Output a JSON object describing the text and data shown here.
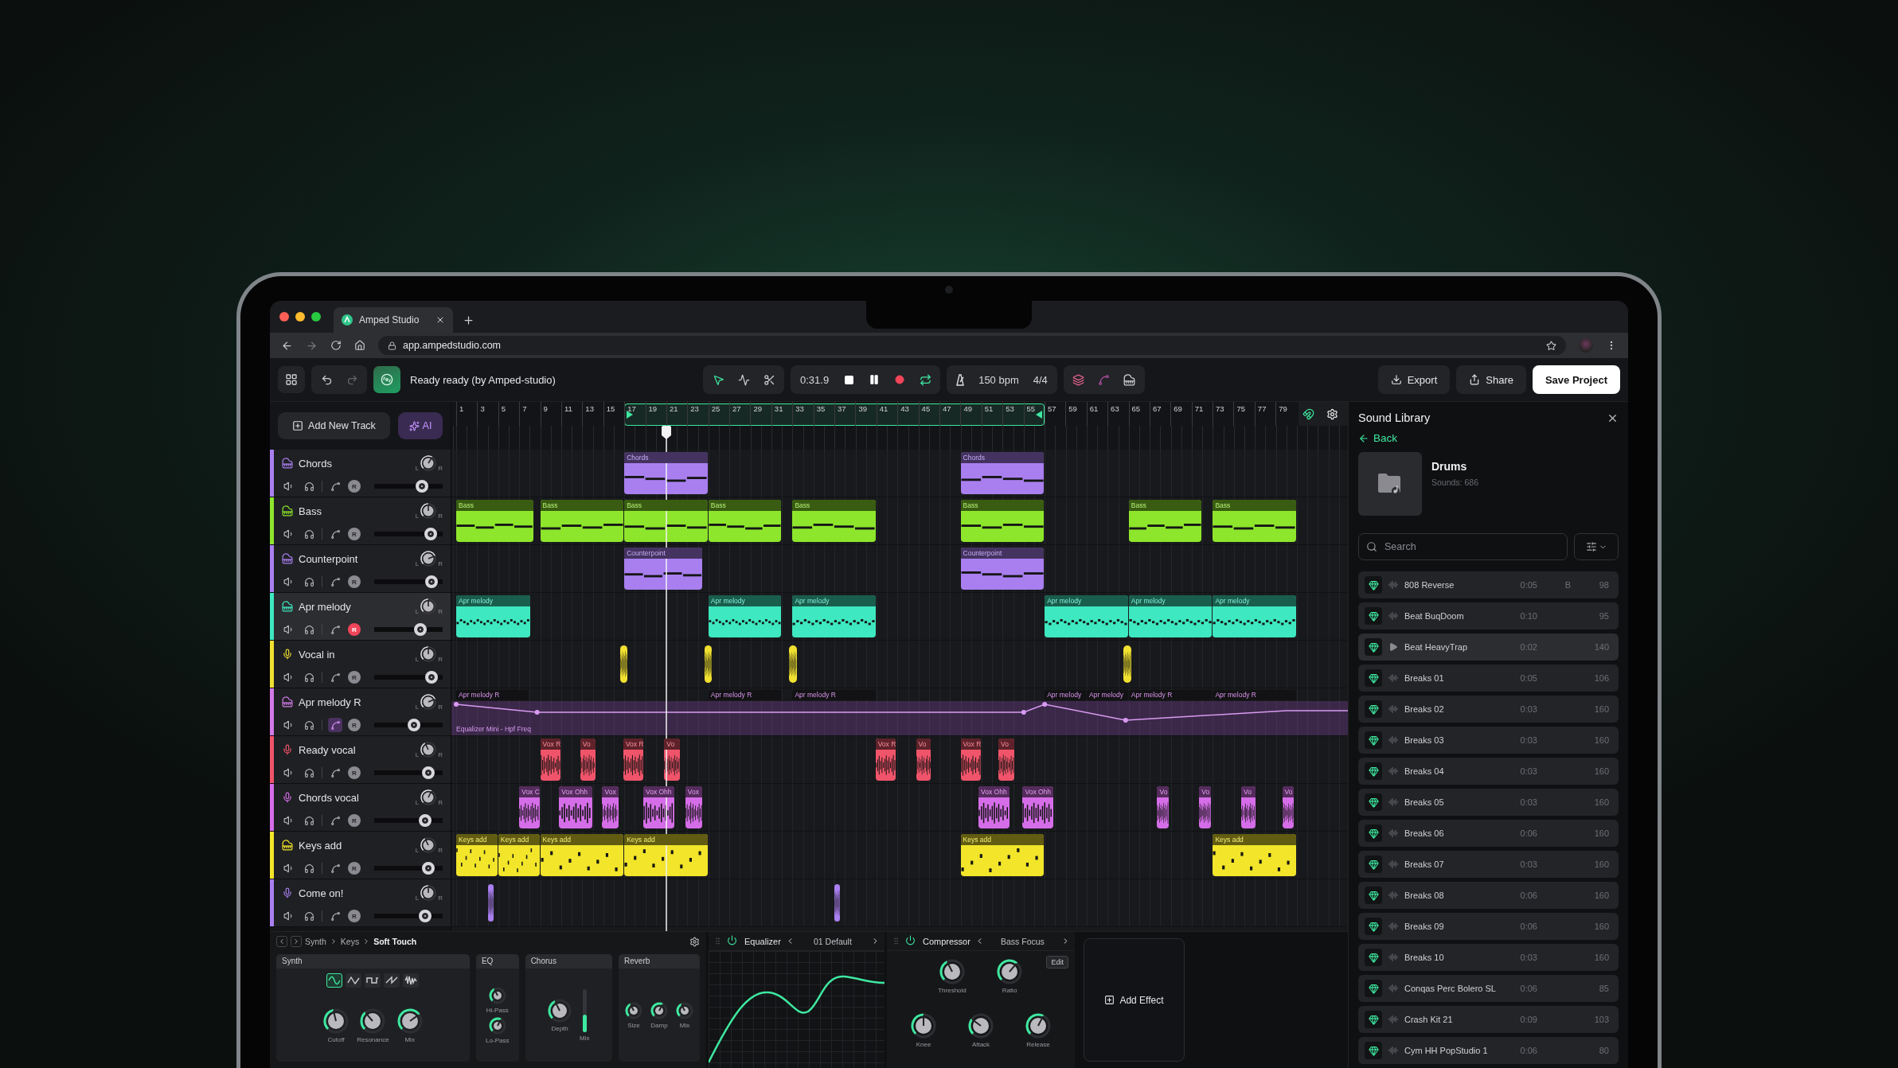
{
  "browser": {
    "tab": {
      "title": "Amped Studio",
      "selected": true
    },
    "url": "app.ampedstudio.com"
  },
  "toolbar": {
    "project_title": "Ready ready (by Amped-studio)",
    "tools": [
      {
        "kind": "pointer",
        "selected": true
      },
      {
        "kind": "split",
        "selected": false
      },
      {
        "kind": "cut",
        "selected": false
      }
    ],
    "time": "0:31.9",
    "loop": true,
    "tempo": "150 bpm",
    "meter": "4/4",
    "buttons": [
      {
        "kind": "export",
        "label": "Export"
      },
      {
        "kind": "share",
        "label": "Share"
      },
      {
        "kind": "save",
        "label": "Save Project"
      }
    ]
  },
  "track_list": {
    "add_button": "Add New Track",
    "ai_button": "AI"
  },
  "ruler": {
    "marks": [
      "1",
      "3",
      "5",
      "7",
      "9",
      "11",
      "13",
      "15",
      "17",
      "19",
      "21",
      "23",
      "25",
      "27",
      "29",
      "31",
      "33",
      "35",
      "37",
      "39",
      "41",
      "43",
      "45",
      "47",
      "49",
      "51",
      "53",
      "55",
      "57",
      "59",
      "61",
      "63",
      "65",
      "67",
      "69",
      "71",
      "73",
      "75",
      "77",
      "79"
    ]
  },
  "tracks": [
    {
      "name": "Chords",
      "kind": "midi",
      "color": "#a97ff0",
      "selected": false,
      "automation": false,
      "pan": {
        "left": "L",
        "right": "R",
        "level": 0.62
      },
      "record": {
        "label": "R",
        "armed": false
      },
      "volume": {
        "level": 0.74
      },
      "clips": [
        {
          "label": "Chords"
        },
        {
          "label": "Chords"
        }
      ]
    },
    {
      "name": "Bass",
      "kind": "midi",
      "color": "#8ee62c",
      "selected": false,
      "automation": false,
      "pan": {
        "left": "L",
        "right": "R",
        "level": 0.5
      },
      "record": {
        "label": "R",
        "armed": false
      },
      "volume": {
        "level": 0.9
      },
      "clips": [
        {
          "label": "Bass"
        },
        {
          "label": "Bass"
        },
        {
          "label": "Bass"
        },
        {
          "label": "Bass"
        },
        {
          "label": "Bass"
        },
        {
          "label": "Bass"
        },
        {
          "label": "Bass"
        },
        {
          "label": "Bass"
        }
      ]
    },
    {
      "name": "Counterpoint",
      "kind": "midi",
      "color": "#a97ff0",
      "selected": false,
      "automation": false,
      "pan": {
        "left": "L",
        "right": "R",
        "level": 0.75
      },
      "record": {
        "label": "R",
        "armed": false
      },
      "volume": {
        "level": 0.92
      },
      "clips": [
        {
          "label": "Counterpoint"
        },
        {
          "label": "Counterpoint"
        }
      ]
    },
    {
      "name": "Apr melody",
      "kind": "midi",
      "color": "#3ee8c0",
      "selected": true,
      "automation": false,
      "pan": {
        "left": "L",
        "right": "R",
        "level": 0.5
      },
      "record": {
        "label": "R",
        "armed": true
      },
      "volume": {
        "level": 0.72
      },
      "clips": [
        {
          "label": "Apr melody"
        },
        {
          "label": "Apr melody"
        },
        {
          "label": "Apr melody"
        },
        {
          "label": "Apr melody"
        },
        {
          "label": "Apr melody"
        },
        {
          "label": "Apr melody"
        }
      ]
    },
    {
      "name": "Vocal in",
      "kind": "audio",
      "color": "#f0e030",
      "selected": false,
      "automation": false,
      "pan": {
        "left": "L",
        "right": "R",
        "level": 0.5
      },
      "record": {
        "label": "R",
        "armed": false
      },
      "volume": {
        "level": 0.92
      },
      "clips": [
        {
          "kind": "audio"
        },
        {
          "kind": "audio"
        },
        {
          "kind": "audio"
        },
        {
          "kind": "audio"
        }
      ]
    },
    {
      "name": "Apr melody R",
      "kind": "midi",
      "color": "#d17ae8",
      "selected": false,
      "automation": true,
      "pan": {
        "left": "L",
        "right": "R",
        "level": 0.75
      },
      "record": {
        "label": "R",
        "armed": false
      },
      "volume": {
        "level": 0.6
      },
      "automation_lane": {
        "label": "Equalizer Mini - Hpf Freq"
      },
      "clips": [
        {
          "label": "Apr melody R"
        },
        {
          "label": "Apr melody R"
        },
        {
          "label": "Apr melody R"
        },
        {
          "label": "Apr melody"
        },
        {
          "label": "Apr melody"
        },
        {
          "label": "Apr melody R"
        },
        {
          "label": "Apr melody R"
        }
      ]
    },
    {
      "name": "Ready vocal",
      "kind": "audio",
      "color": "#f0546a",
      "selected": false,
      "automation": false,
      "pan": {
        "left": "L",
        "right": "R",
        "level": 0.4
      },
      "record": {
        "label": "R",
        "armed": false
      },
      "volume": {
        "level": 0.86
      },
      "clips": [
        {
          "label": "Vox R"
        },
        {
          "label": "Vo"
        },
        {
          "label": "Vox R"
        },
        {
          "label": "Vo"
        },
        {
          "label": "Vox R"
        },
        {
          "label": "Vo"
        },
        {
          "label": "Vox R"
        },
        {
          "label": "Vo"
        }
      ]
    },
    {
      "name": "Chords vocal",
      "kind": "audio",
      "color": "#d56de8",
      "selected": false,
      "automation": false,
      "pan": {
        "left": "L",
        "right": "R",
        "level": 0.6
      },
      "record": {
        "label": "R",
        "armed": false
      },
      "volume": {
        "level": 0.8
      },
      "clips": [
        {
          "label": "Vox C"
        },
        {
          "label": "Vox Ohh"
        },
        {
          "label": "Vox"
        },
        {
          "label": "Vox Ohh"
        },
        {
          "label": "Vox"
        },
        {
          "label": "Vox Ohh"
        },
        {
          "label": "Vox Ohh"
        },
        {
          "label": "Vo"
        },
        {
          "label": "Vo"
        },
        {
          "label": "Vo"
        },
        {
          "label": "Vo"
        }
      ]
    },
    {
      "name": "Keys add",
      "kind": "midi",
      "color": "#f2e52a",
      "selected": false,
      "automation": false,
      "pan": {
        "left": "L",
        "right": "R",
        "level": 0.4
      },
      "record": {
        "label": "R",
        "armed": false
      },
      "volume": {
        "level": 0.86
      },
      "clips": [
        {
          "label": "Keys add"
        },
        {
          "label": "Keys add"
        },
        {
          "label": "Keys add"
        },
        {
          "label": "Keys add"
        },
        {
          "label": "Keys add"
        },
        {
          "label": "Keys add"
        }
      ]
    },
    {
      "name": "Come on!",
      "kind": "audio",
      "color": "#a97ff0",
      "selected": false,
      "automation": false,
      "pan": {
        "left": "L",
        "right": "R",
        "level": 0.5
      },
      "record": {
        "label": "R",
        "armed": false
      },
      "volume": {
        "level": 0.8
      },
      "clips": [
        {
          "kind": "audio"
        },
        {
          "kind": "audio"
        }
      ]
    }
  ],
  "instrument": {
    "breadcrumb": [
      "Synth",
      "Keys",
      "Soft Touch"
    ],
    "modules": [
      {
        "title": "Synth",
        "kind": "synth",
        "waves": [
          {
            "kind": "sine",
            "selected": true
          },
          {
            "kind": "triangle",
            "selected": false
          },
          {
            "kind": "square",
            "selected": false
          },
          {
            "kind": "saw",
            "selected": false
          },
          {
            "kind": "noise",
            "selected": false
          }
        ],
        "knobs": [
          {
            "label": "Cutoff",
            "level": 0.45
          },
          {
            "label": "Resonance",
            "level": 0.35
          },
          {
            "label": "Mix",
            "level": 0.7
          }
        ]
      },
      {
        "title": "EQ",
        "kind": "eq",
        "knobs": [
          {
            "label": "Hi-Pass",
            "level": 0.4
          },
          {
            "label": "Lo-Pass",
            "level": 0.6
          }
        ]
      },
      {
        "title": "Chorus",
        "kind": "chorus",
        "knobs": [
          {
            "label": "Depth",
            "level": 0.4
          }
        ],
        "fader": {
          "label": "Mix",
          "level": 0.4
        }
      },
      {
        "title": "Reverb",
        "kind": "reverb",
        "knobs": [
          {
            "label": "Size",
            "level": 0.4
          },
          {
            "label": "Damp",
            "level": 0.6
          },
          {
            "label": "Mix",
            "level": 0.4
          }
        ]
      }
    ]
  },
  "effects": [
    {
      "kind": "equalizer",
      "name": "Equalizer",
      "on": true,
      "preset": "01 Default"
    },
    {
      "kind": "compressor",
      "name": "Compressor",
      "on": true,
      "preset": "Bass Focus",
      "edit": "Edit",
      "knobs": [
        {
          "label": "Threshold",
          "level": 0.4
        },
        {
          "label": "Ratio",
          "level": 0.65
        },
        {
          "label": "Knee",
          "level": 0.5
        },
        {
          "label": "Attack",
          "level": 0.3
        },
        {
          "label": "Release",
          "level": 0.6
        }
      ]
    }
  ],
  "add_effect": "Add Effect",
  "library": {
    "title": "Sound Library",
    "back": "Back",
    "folder": {
      "name": "Drums",
      "count": "Sounds: 686"
    },
    "search": {
      "placeholder": "Search"
    },
    "items": [
      {
        "name": "808 Reverse",
        "duration": "0:05",
        "key": "B",
        "bpm": "98",
        "hovered": false
      },
      {
        "name": "Beat BuqDoom",
        "duration": "0:10",
        "bpm": "95",
        "hovered": false
      },
      {
        "name": "Beat HeavyTrap",
        "duration": "0:02",
        "bpm": "140",
        "hovered": true
      },
      {
        "name": "Breaks 01",
        "duration": "0:05",
        "bpm": "106",
        "hovered": false
      },
      {
        "name": "Breaks 02",
        "duration": "0:03",
        "bpm": "160",
        "hovered": false
      },
      {
        "name": "Breaks 03",
        "duration": "0:03",
        "bpm": "160",
        "hovered": false
      },
      {
        "name": "Breaks 04",
        "duration": "0:03",
        "bpm": "160",
        "hovered": false
      },
      {
        "name": "Breaks 05",
        "duration": "0:03",
        "bpm": "160",
        "hovered": false
      },
      {
        "name": "Breaks 06",
        "duration": "0:06",
        "bpm": "160",
        "hovered": false
      },
      {
        "name": "Breaks 07",
        "duration": "0:03",
        "bpm": "160",
        "hovered": false
      },
      {
        "name": "Breaks 08",
        "duration": "0:06",
        "bpm": "160",
        "hovered": false
      },
      {
        "name": "Breaks 09",
        "duration": "0:06",
        "bpm": "160",
        "hovered": false
      },
      {
        "name": "Breaks 10",
        "duration": "0:03",
        "bpm": "160",
        "hovered": false
      },
      {
        "name": "Conqas Perc Bolero SL",
        "duration": "0:06",
        "bpm": "85",
        "hovered": false
      },
      {
        "name": "Crash Kit 21",
        "duration": "0:09",
        "bpm": "103",
        "hovered": false
      },
      {
        "name": "Cym HH PopStudio 1",
        "duration": "0:06",
        "bpm": "80",
        "hovered": false
      }
    ]
  }
}
